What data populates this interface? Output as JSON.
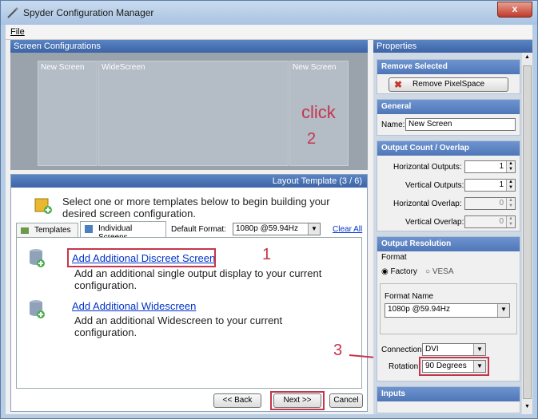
{
  "window": {
    "title": "Spyder Configuration Manager",
    "close": "x"
  },
  "menu": {
    "file": "File"
  },
  "screens": {
    "header": "Screen Configurations",
    "items": [
      "New Screen",
      "WideScreen",
      "New Screen"
    ],
    "annotation_click": "click",
    "annotation_2": "2"
  },
  "layout": {
    "header": "Layout Template (3 / 6)",
    "intro": "Select one or more templates below to begin building your desired screen configuration.",
    "tabs": [
      "Templates",
      "Individual Screens"
    ],
    "default_format_label": "Default Format:",
    "default_format_value": "1080p @59.94Hz",
    "clear_all": "Clear All",
    "templates": [
      {
        "title": "Add Additional Discreet Screen",
        "desc": "Add an additional single output display to your current configuration."
      },
      {
        "title": "Add Additional Widescreen",
        "desc": "Add an additional Widescreen to your current configuration."
      }
    ],
    "annotation_1": "1",
    "buttons": {
      "back": "<< Back",
      "next": "Next >>",
      "cancel": "Cancel"
    }
  },
  "properties": {
    "header": "Properties",
    "remove": {
      "title": "Remove Selected",
      "button": "Remove PixelSpace"
    },
    "general": {
      "title": "General",
      "name_label": "Name:",
      "name_value": "New Screen"
    },
    "output": {
      "title": "Output Count / Overlap",
      "h_outputs_label": "Horizontal Outputs:",
      "h_outputs": "1",
      "v_outputs_label": "Vertical Outputs:",
      "v_outputs": "1",
      "h_overlap_label": "Horizontal Overlap:",
      "h_overlap": "0",
      "v_overlap_label": "Vertical Overlap:",
      "v_overlap": "0"
    },
    "resolution": {
      "title": "Output Resolution",
      "format_label": "Format",
      "factory": "Factory",
      "vesa": "VESA",
      "format_name_label": "Format Name",
      "format_name_value": "1080p @59.94Hz",
      "connection_label": "Connection",
      "connection_value": "DVI",
      "rotation_label": "Rotation:",
      "rotation_value": "90 Degrees"
    },
    "inputs": {
      "title": "Inputs"
    },
    "annotation_3": "3"
  },
  "colors": {
    "annotation": "#c4364b",
    "header": "#4f76b8",
    "link": "#0033cc"
  }
}
